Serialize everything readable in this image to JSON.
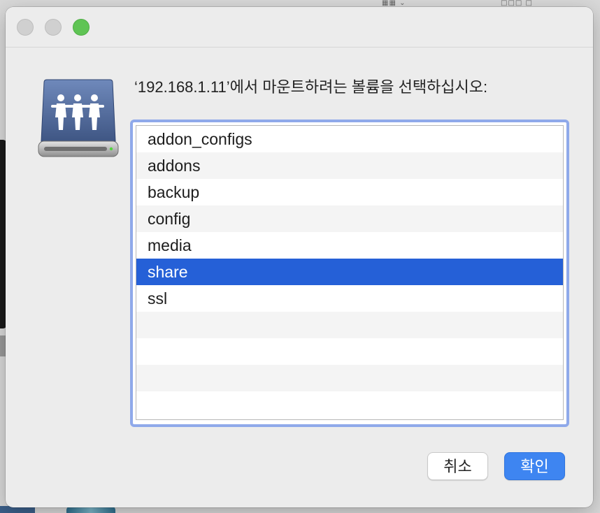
{
  "dialog": {
    "prompt": "‘192.168.1.11’에서 마운트하려는 볼륨을 선택하십시오:",
    "volumes": [
      {
        "label": "addon_configs",
        "selected": false
      },
      {
        "label": "addons",
        "selected": false
      },
      {
        "label": "backup",
        "selected": false
      },
      {
        "label": "config",
        "selected": false
      },
      {
        "label": "media",
        "selected": false
      },
      {
        "label": "share",
        "selected": true
      },
      {
        "label": "ssl",
        "selected": false
      },
      {
        "label": "",
        "selected": false
      },
      {
        "label": "",
        "selected": false
      },
      {
        "label": "",
        "selected": false
      },
      {
        "label": "",
        "selected": false
      }
    ],
    "buttons": {
      "cancel": "취소",
      "ok": "확인"
    }
  },
  "colors": {
    "selection": "#2560d7",
    "focus_ring": "#8fa9ea",
    "default_button": "#3e85f1",
    "zoom_light": "#5fc454"
  },
  "icons": {
    "drive": "shared-network-drive-icon"
  }
}
